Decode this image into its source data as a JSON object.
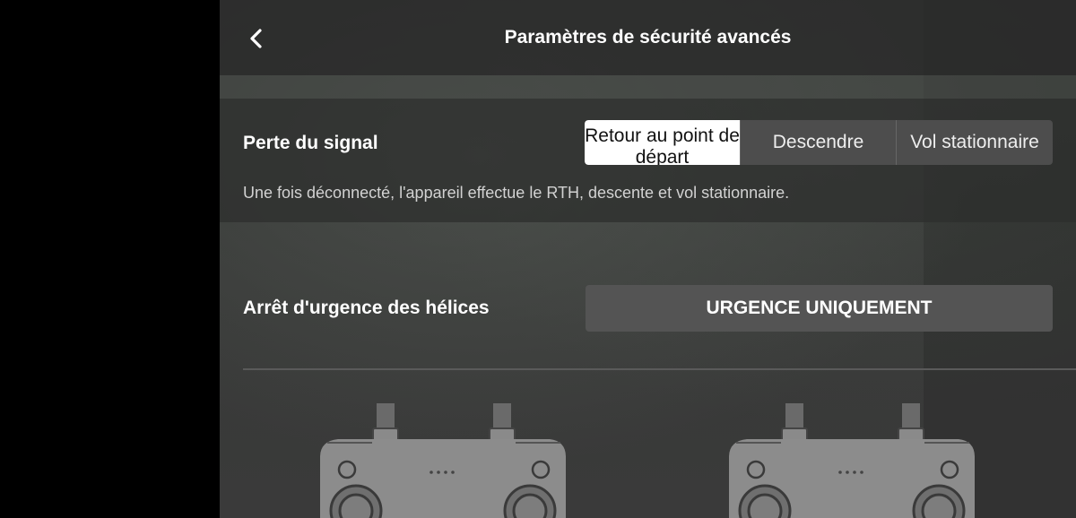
{
  "header": {
    "title": "Paramètres de sécurité avancés",
    "back_icon": "chevron-left-icon"
  },
  "signal_loss": {
    "label": "Perte du signal",
    "options": [
      "Retour au point de départ",
      "Descendre",
      "Vol stationnaire"
    ],
    "selected": "Retour au point de départ",
    "description": "Une fois déconnecté, l'appareil effectue le RTH, descente et vol stationnaire."
  },
  "emergency_stop": {
    "label": "Arrêt d'urgence des hélices",
    "value": "URGENCE UNIQUEMENT"
  },
  "illustrations": [
    "remote-controller-icon",
    "remote-controller-icon"
  ],
  "colors": {
    "selected_bg": "#ffffff",
    "button_bg": "#545454",
    "text": "#ffffff"
  }
}
